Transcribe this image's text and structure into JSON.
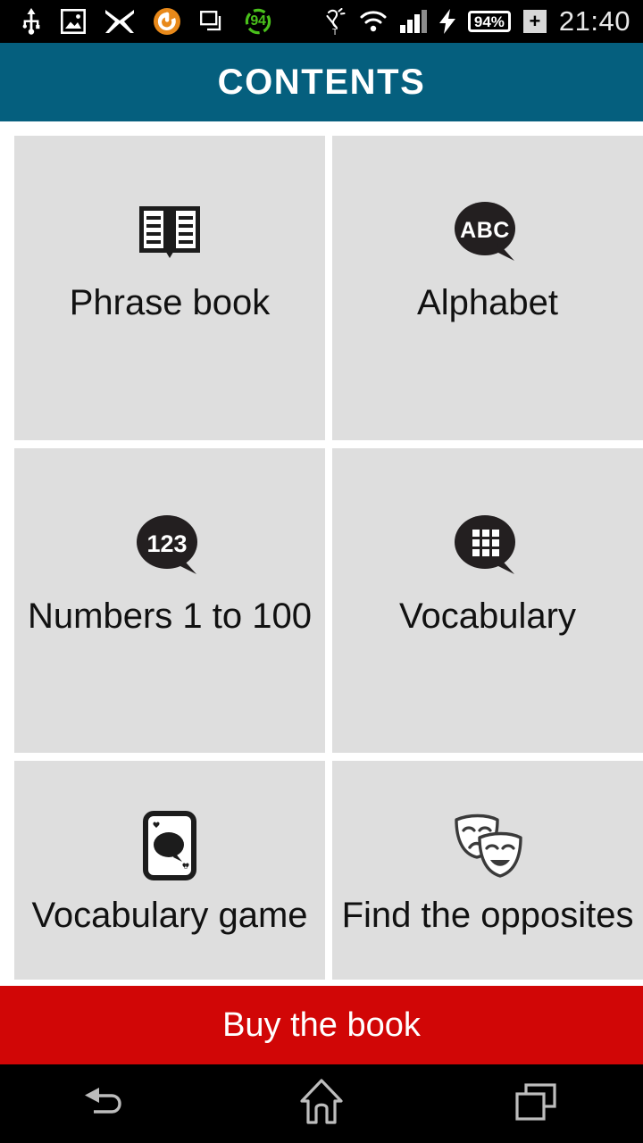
{
  "status_bar": {
    "left_icons": [
      {
        "name": "usb-icon",
        "label": "USB"
      },
      {
        "name": "screenshot-image-icon",
        "label": "Screenshot"
      },
      {
        "name": "mail-icon",
        "label": "Mail"
      },
      {
        "name": "app-orange-icon",
        "label": "App notification"
      },
      {
        "name": "screen-mirroring-icon",
        "label": "Screen mirroring"
      },
      {
        "name": "optimizer-score-icon",
        "label": "94"
      }
    ],
    "score_badge": "94",
    "right_icons": [
      {
        "name": "hearing-aid-icon",
        "label": "Hearing aid T"
      },
      {
        "name": "wifi-icon",
        "label": "Wi-Fi"
      },
      {
        "name": "cellular-signal-icon",
        "label": "Signal"
      },
      {
        "name": "charging-bolt-icon",
        "label": "Charging"
      }
    ],
    "battery_percent": "94%",
    "stamina_plus": "+",
    "clock": "21:40",
    "background_color": "#000000"
  },
  "header": {
    "title": "CONTENTS",
    "background_color": "#055f7e",
    "text_color": "#ffffff"
  },
  "grid": {
    "tile_background": "#dedede",
    "rows": [
      [
        {
          "label": "Phrase book",
          "icon": "open-book-icon",
          "name": "tile-phrase-book"
        },
        {
          "label": "Alphabet",
          "icon": "abc-speech-bubble-icon",
          "name": "tile-alphabet",
          "bubble_text": "ABC"
        }
      ],
      [
        {
          "label": "Numbers 1 to 100",
          "icon": "123-speech-bubble-icon",
          "name": "tile-numbers",
          "bubble_text": "123"
        },
        {
          "label": "Vocabulary",
          "icon": "grid-speech-bubble-icon",
          "name": "tile-vocabulary"
        }
      ],
      [
        {
          "label": "Vocabulary game",
          "icon": "playing-card-speech-bubble-icon",
          "name": "tile-vocabulary-game"
        },
        {
          "label": "Find the opposites",
          "icon": "theater-masks-icon",
          "name": "tile-find-opposites"
        }
      ]
    ]
  },
  "buy_button": {
    "label": "Buy the book",
    "background_color": "#d10606",
    "text_color": "#ffffff"
  },
  "nav_bar": {
    "background_color": "#000000",
    "buttons": [
      {
        "name": "nav-back-button",
        "icon": "back-arrow-icon",
        "label": "Back"
      },
      {
        "name": "nav-home-button",
        "icon": "home-icon",
        "label": "Home"
      },
      {
        "name": "nav-recents-button",
        "icon": "recents-icon",
        "label": "Recent apps"
      }
    ]
  }
}
